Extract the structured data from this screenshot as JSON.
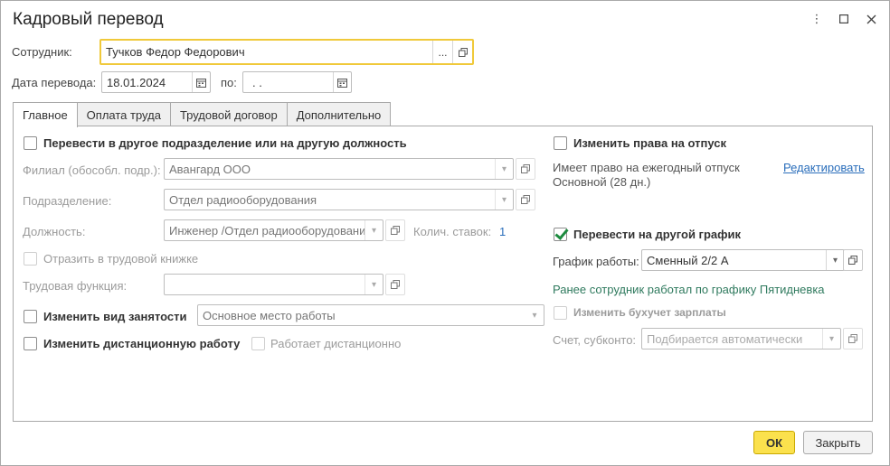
{
  "window": {
    "title": "Кадровый перевод",
    "menu_icon": "⋮",
    "maximize_icon": "□",
    "close_icon": "✕"
  },
  "header": {
    "employee_label": "Сотрудник:",
    "employee_value": "Тучков Федор Федорович",
    "employee_select_btn": "...",
    "date_label": "Дата перевода:",
    "date_value": "18.01.2024",
    "date_to_label": "по:",
    "date_to_value": " .  ."
  },
  "tabs": [
    {
      "label": "Главное",
      "active": true
    },
    {
      "label": "Оплата труда"
    },
    {
      "label": "Трудовой договор"
    },
    {
      "label": "Дополнительно"
    }
  ],
  "left": {
    "transfer_label": "Перевести в другое подразделение или на другую должность",
    "branch_label": "Филиал (обособл. подр.):",
    "branch_value": "Авангард ООО",
    "department_label": "Подразделение:",
    "department_value": "Отдел радиооборудования",
    "position_label": "Должность:",
    "position_value": "Инженер /Отдел радиооборудовани",
    "rates_label": "Колич. ставок:",
    "rates_value": "1",
    "workbook_label": "Отразить в трудовой книжке",
    "labor_function_label": "Трудовая функция:",
    "labor_function_value": "",
    "employment_type_label": "Изменить вид занятости",
    "employment_type_value": "Основное место работы",
    "remote_label": "Изменить дистанционную работу",
    "works_remote_label": "Работает дистанционно"
  },
  "right": {
    "vacation_label": "Изменить права на отпуск",
    "vacation_info_line1": "Имеет право на ежегодный отпуск",
    "vacation_info_line2": "Основной (28 дн.)",
    "edit_link": "Редактировать",
    "schedule_transfer_label": "Перевести на другой график",
    "schedule_label": "График работы:",
    "schedule_value": "Сменный 2/2 А",
    "previous_schedule": "Ранее сотрудник работал по графику Пятидневка",
    "accounting_label": "Изменить бухучет зарплаты",
    "account_label": "Счет, субконто:",
    "account_placeholder": "Подбирается автоматически"
  },
  "footer": {
    "ok_label": "ОК",
    "close_label": "Закрыть"
  },
  "colors": {
    "accent_yellow": "#fbe14d",
    "focus_border": "#f0c93a",
    "link": "#2a6ebb",
    "check_green": "#1c8a3e"
  }
}
